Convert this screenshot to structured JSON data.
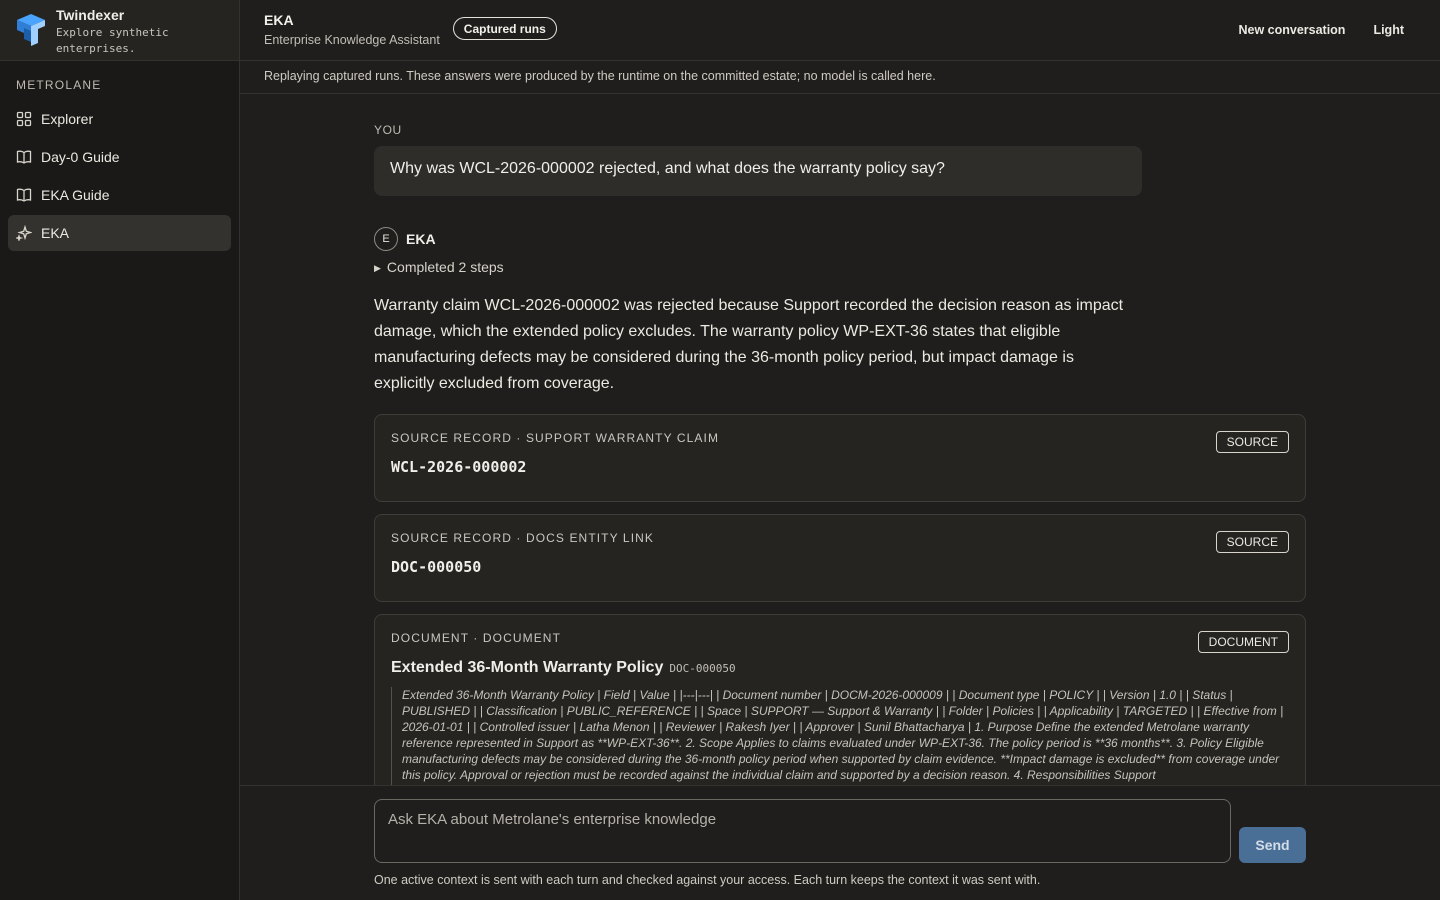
{
  "brand": {
    "name": "Twindexer",
    "tagline": "Explore synthetic enterprises."
  },
  "sidebar": {
    "section": "METROLANE",
    "items": [
      {
        "label": "Explorer",
        "icon": "grid-icon"
      },
      {
        "label": "Day-0 Guide",
        "icon": "book-icon"
      },
      {
        "label": "EKA Guide",
        "icon": "book-icon"
      },
      {
        "label": "EKA",
        "icon": "sparkle-icon",
        "active": true
      }
    ]
  },
  "header": {
    "title": "EKA",
    "subtitle": "Enterprise Knowledge Assistant",
    "pill": "Captured runs",
    "new_conversation": "New conversation",
    "theme": "Light"
  },
  "notice": "Replaying captured runs. These answers were produced by the runtime on the committed estate; no model is called here.",
  "conversation": {
    "you_label": "YOU",
    "question": "Why was WCL-2026-000002 rejected, and what does the warranty policy say?",
    "assistant_initial": "E",
    "assistant_name": "EKA",
    "steps": "Completed 2 steps",
    "answer": "Warranty claim WCL-2026-000002 was rejected because Support recorded the decision reason as impact damage, which the extended policy excludes. The warranty policy WP-EXT-36 states that eligible manufacturing defects may be considered during the 36-month policy period, but impact damage is explicitly excluded from coverage.",
    "cards": [
      {
        "kind": "SOURCE RECORD · SUPPORT WARRANTY CLAIM",
        "id": "WCL-2026-000002",
        "badge": "SOURCE"
      },
      {
        "kind": "SOURCE RECORD · DOCS ENTITY LINK",
        "id": "DOC-000050",
        "badge": "SOURCE"
      }
    ],
    "document": {
      "kind": "DOCUMENT · DOCUMENT",
      "badge": "DOCUMENT",
      "title": "Extended 36-Month Warranty Policy",
      "id": "DOC-000050",
      "excerpt": "Extended 36-Month Warranty Policy | Field | Value | |---|---| | Document number | DOCM-2026-000009 | | Document type | POLICY | | Version | 1.0 | | Status | PUBLISHED | | Classification | PUBLIC_REFERENCE | | Space | SUPPORT — Support & Warranty | | Folder | Policies | | Applicability | TARGETED | | Effective from | 2026-01-01 | | Controlled issuer | Latha Menon | | Reviewer | Rakesh Iyer | | Approver | Sunil Bhattacharya | 1. Purpose Define the extended Metrolane warranty reference represented in Support as **WP-EXT-36**. 2. Scope Applies to claims evaluated under WP-EXT-36. The policy period is **36 months**. 3. Policy Eligible manufacturing defects may be considered during the 36-month policy period when supported by claim evidence. **Impact damage is excluded** from coverage under this policy. Approval or rejection must be recorded against the individual claim and supported by a decision reason. 4. Responsibilities Support"
    }
  },
  "composer": {
    "placeholder": "Ask EKA about Metrolane's enterprise knowledge",
    "send": "Send",
    "note": "One active context is sent with each turn and checked against your access. Each turn keeps the context it was sent with."
  }
}
